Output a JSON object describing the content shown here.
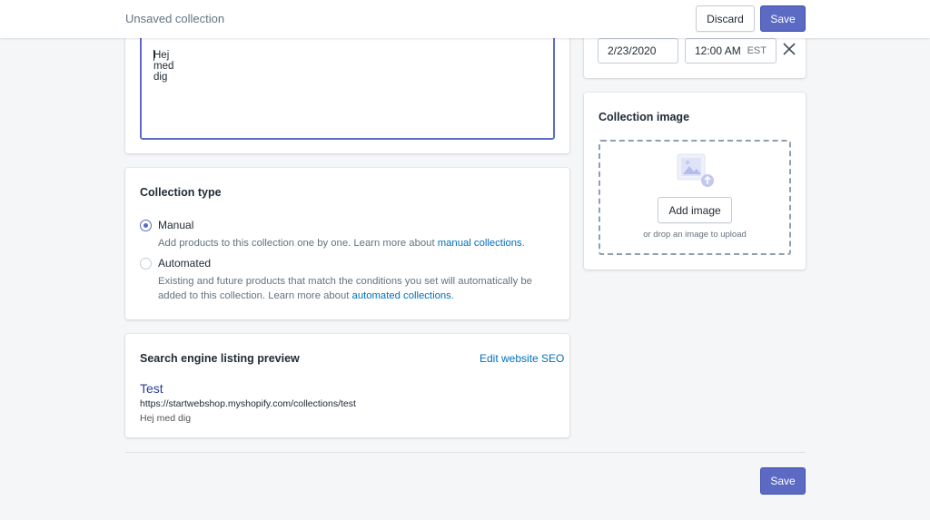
{
  "topbar": {
    "title": "Unsaved collection",
    "discard_label": "Discard",
    "save_label": "Save"
  },
  "description": {
    "text": "Hej med dig"
  },
  "collection_type": {
    "title": "Collection type",
    "options": [
      {
        "label": "Manual",
        "checked": true,
        "help_text": "Add products to this collection one by one. Learn more about ",
        "help_link": "manual collections",
        "help_suffix": "."
      },
      {
        "label": "Automated",
        "checked": false,
        "help_line1": "Existing and future products that match the conditions you set will automatically be",
        "help_line2": "added to this collection. Learn more about ",
        "help_link": "automated collections",
        "help_suffix": "."
      }
    ]
  },
  "seo": {
    "title": "Search engine listing preview",
    "edit_link": "Edit website SEO",
    "preview_title": "Test",
    "preview_url": "https://startwebshop.myshopify.com/collections/test",
    "preview_description": "Hej med dig"
  },
  "availability": {
    "date": "2/23/2020",
    "time": "12:00 AM",
    "timezone": "EST"
  },
  "collection_image": {
    "title": "Collection image",
    "add_label": "Add image",
    "drop_hint": "or drop an image to upload"
  },
  "footer": {
    "save_label": "Save"
  },
  "colors": {
    "primary": "#5c6ac4",
    "link": "#006fbb",
    "background": "#f4f6f8"
  }
}
